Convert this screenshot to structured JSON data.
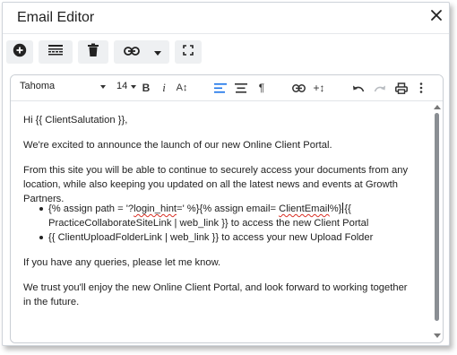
{
  "dialog": {
    "title": "Email Editor",
    "close_icon": "close-icon"
  },
  "toolbar": {
    "buttons": [
      {
        "icon": "add-circle-icon"
      },
      {
        "icon": "insert-template-icon"
      },
      {
        "icon": "trash-icon"
      },
      {
        "icon": "link-icon",
        "dropdown_icon": "caret-down-icon"
      },
      {
        "icon": "fullscreen-icon"
      }
    ]
  },
  "editor_toolbar": {
    "font": "Tahoma",
    "size": "14",
    "icons": [
      "bold-icon",
      "italic-icon",
      "font-size-icon",
      "align-left-icon",
      "align-center-icon",
      "paragraph-icon",
      "link-icon",
      "insert-icon",
      "undo-icon",
      "redo-icon",
      "print-icon",
      "more-vert-icon"
    ],
    "bold_label": "B",
    "italic_label": "i",
    "fontsize_label": "A↕",
    "paragraph_label": "¶",
    "insert_label": "+↕"
  },
  "content": {
    "greeting": "Hi {{ ClientSalutation }},",
    "p1": "We're excited to announce the launch of our new Online Client Portal.",
    "p2": "From this site you will be able to continue to securely access your documents from any location, while also keeping you updated on all the latest news and events at Growth Partners.",
    "li1_part1": "{% assign path = '?",
    "li1_part2": "login_hint",
    "li1_part3": "=' %}{% assign email= ",
    "li1_part4": "ClientEmail",
    "li1_part5": "%}",
    "li1_part6": "{{ PracticeCollaborateSiteLink | web_link }} to access the new Client Portal",
    "li2": "{{ ClientUploadFolderLink | web_link }} to access your new Upload Folder",
    "p3": "If you have any queries, please let me know.",
    "p4": "We trust you'll enjoy the new Online Client Portal, and look forward to working together in the future."
  },
  "colors": {
    "accent": "#1a73e8",
    "toolbar_bg": "#eef0f2",
    "spellcheck": "#d93025"
  }
}
